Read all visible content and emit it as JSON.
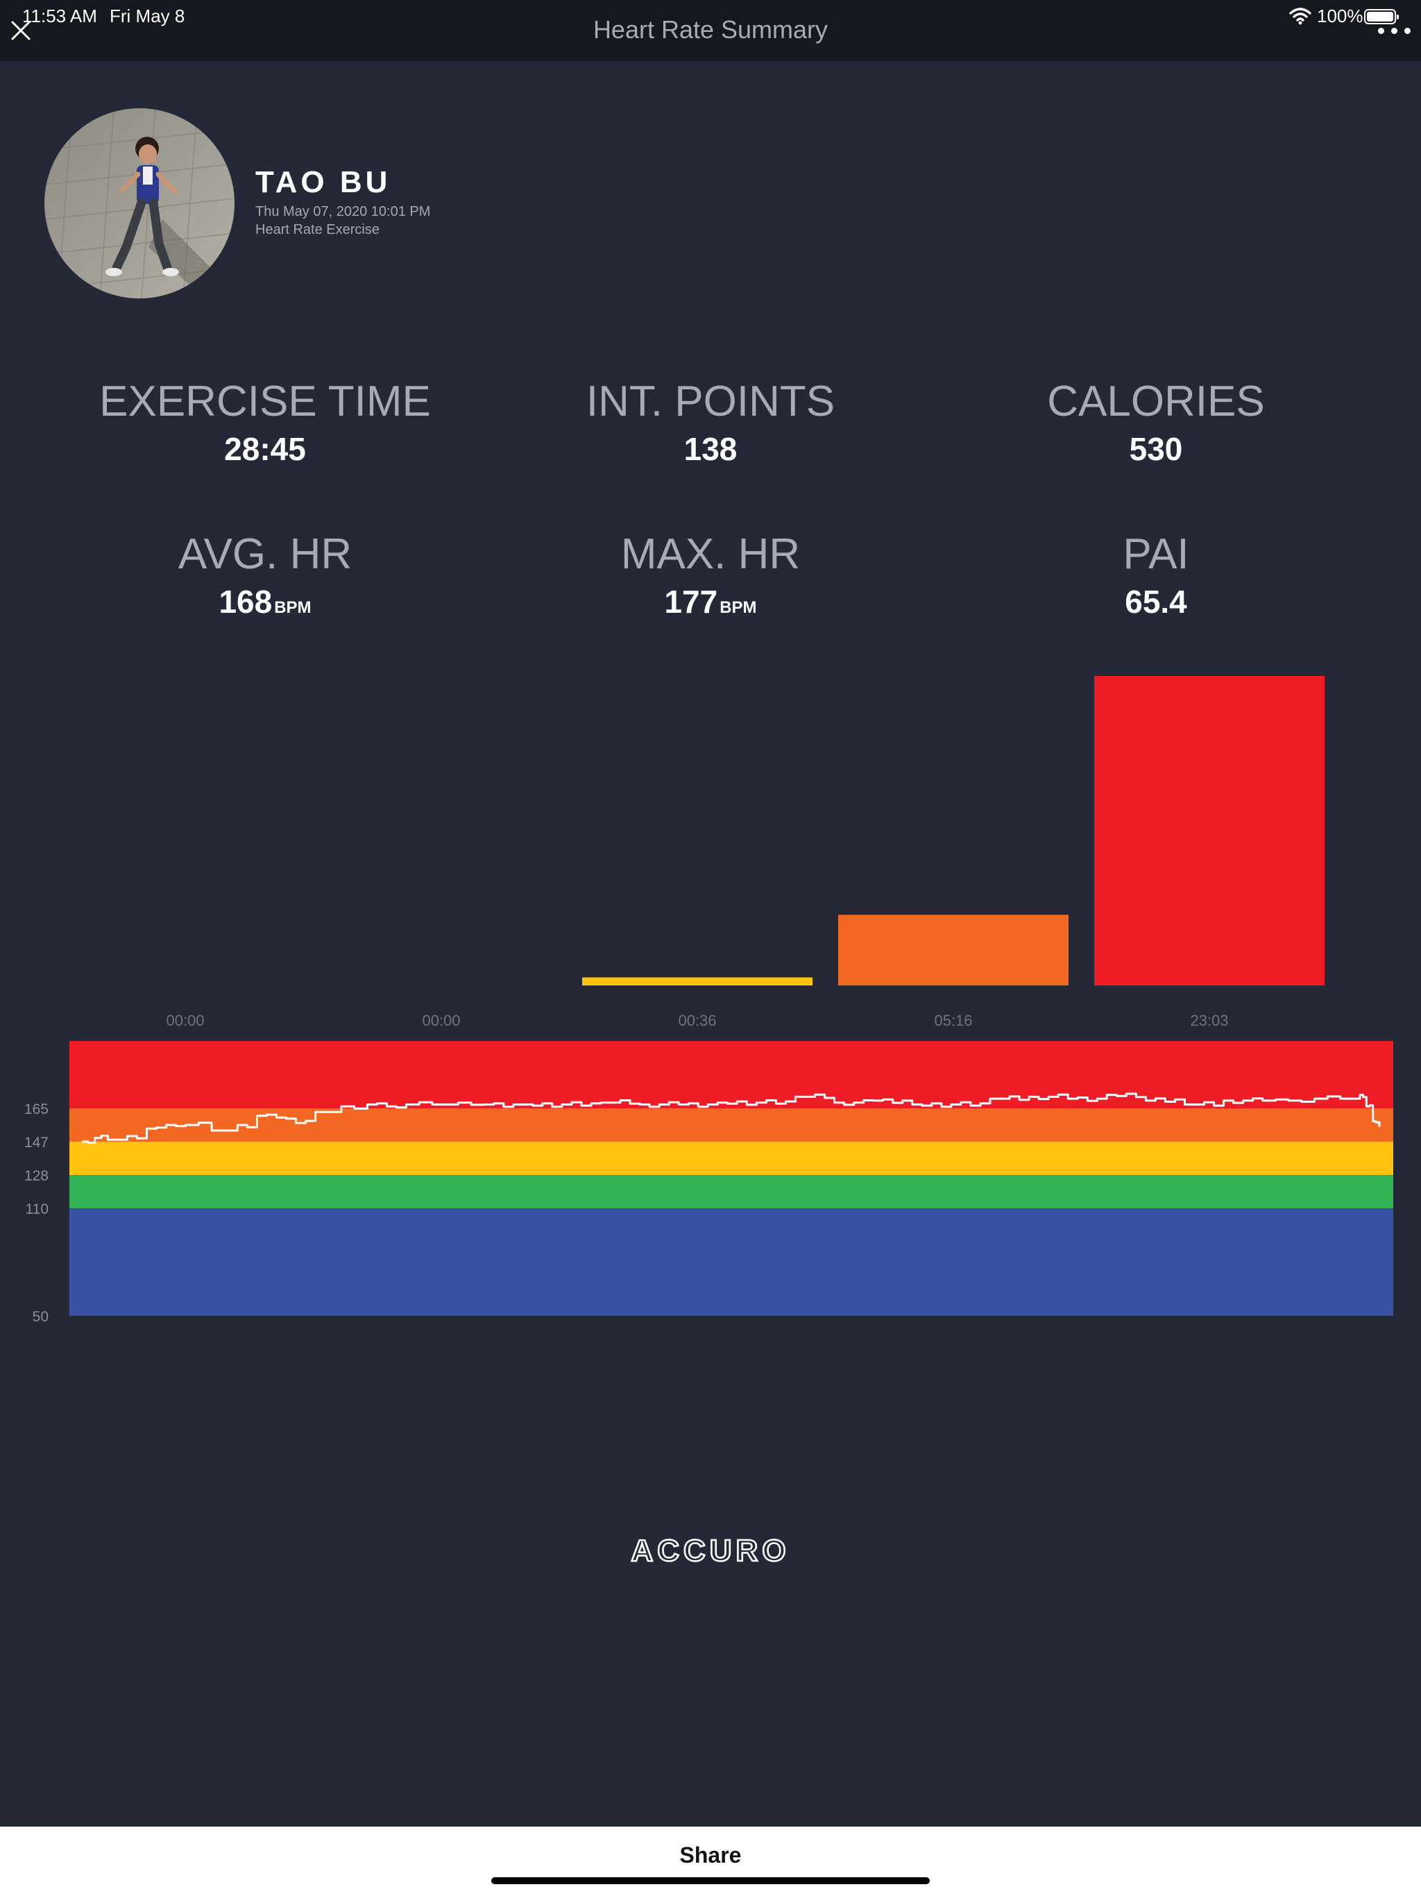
{
  "status_bar": {
    "time": "11:53 AM",
    "date": "Fri May 8",
    "battery": "100%"
  },
  "nav": {
    "title": "Heart Rate Summary"
  },
  "profile": {
    "name": "TAO BU",
    "datetime": "Thu May 07, 2020 10:01 PM",
    "activity": "Heart Rate Exercise"
  },
  "stats": {
    "exercise_time": {
      "label": "EXERCISE TIME",
      "value": "28:45"
    },
    "int_points": {
      "label": "INT. POINTS",
      "value": "138"
    },
    "calories": {
      "label": "CALORIES",
      "value": "530"
    },
    "avg_hr": {
      "label": "AVG. HR",
      "value": "168",
      "unit": "BPM"
    },
    "max_hr": {
      "label": "MAX. HR",
      "value": "177",
      "unit": "BPM"
    },
    "pai": {
      "label": "PAI",
      "value": "65.4"
    }
  },
  "chart_data": [
    {
      "type": "bar",
      "categories": [
        "00:00",
        "00:00",
        "00:36",
        "05:16",
        "23:03"
      ],
      "values": [
        0,
        0,
        36,
        316,
        1383
      ],
      "colors": [
        "#3a52a6",
        "#32b454",
        "#ffc20e",
        "#f26822",
        "#ee1c25"
      ],
      "ylim": [
        0,
        1383
      ],
      "grid": false
    },
    {
      "type": "line",
      "yticks": [
        165,
        147,
        128,
        110,
        50
      ],
      "ylim": [
        50,
        200
      ],
      "zones": [
        {
          "from": 165,
          "to": 200,
          "color": "#ee1c25"
        },
        {
          "from": 147,
          "to": 165,
          "color": "#f26822"
        },
        {
          "from": 128,
          "to": 147,
          "color": "#ffc20e"
        },
        {
          "from": 110,
          "to": 128,
          "color": "#32b454"
        },
        {
          "from": 50,
          "to": 110,
          "color": "#3a52a6"
        }
      ],
      "x": [
        0,
        0.01,
        0.02,
        0.035,
        0.05,
        0.065,
        0.08,
        0.1,
        0.12,
        0.135,
        0.15,
        0.165,
        0.18,
        0.2,
        0.22,
        0.235,
        0.25,
        0.27,
        0.29,
        0.31,
        0.34,
        0.37,
        0.4,
        0.43,
        0.46,
        0.49,
        0.52,
        0.55,
        0.58,
        0.61,
        0.64,
        0.67,
        0.7,
        0.73,
        0.76,
        0.79,
        0.82,
        0.85,
        0.88,
        0.91,
        0.93,
        0.95,
        0.97,
        0.985,
        0.99,
        0.995,
        1.0
      ],
      "values": [
        147,
        149,
        148,
        150,
        154,
        156,
        156,
        153,
        156,
        161,
        160,
        157,
        163,
        166,
        167,
        166,
        167,
        167,
        168,
        167,
        167,
        167,
        168,
        167,
        167,
        168,
        168,
        171,
        168,
        169,
        167,
        167,
        170,
        171,
        170,
        172,
        169,
        167,
        169,
        169,
        169,
        170,
        170,
        172,
        166,
        158,
        155
      ]
    }
  ],
  "footer": {
    "logo_text": "ACCURO",
    "share_label": "Share"
  },
  "colors": {
    "background": "#252937",
    "status_bar": "#16181f",
    "label_gray": "#a6abb7",
    "zone_red": "#ee1c25",
    "zone_orange": "#f26822",
    "zone_yellow": "#ffc20e",
    "zone_green": "#32b454",
    "zone_blue": "#3a52a6"
  }
}
